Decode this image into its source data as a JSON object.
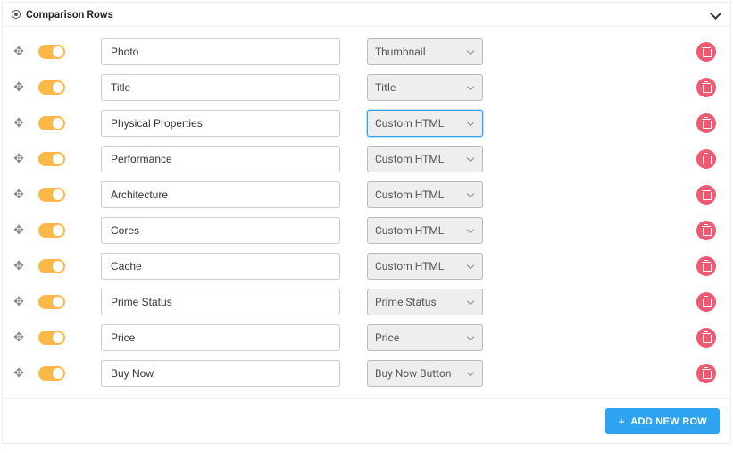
{
  "panel": {
    "title": "Comparison Rows"
  },
  "rows": [
    {
      "enabled": true,
      "name": "Photo",
      "type": "Thumbnail",
      "focused": false
    },
    {
      "enabled": true,
      "name": "Title",
      "type": "Title",
      "focused": false
    },
    {
      "enabled": true,
      "name": "Physical Properties",
      "type": "Custom HTML",
      "focused": true
    },
    {
      "enabled": true,
      "name": "Performance",
      "type": "Custom HTML",
      "focused": false
    },
    {
      "enabled": true,
      "name": "Architecture",
      "type": "Custom HTML",
      "focused": false
    },
    {
      "enabled": true,
      "name": "Cores",
      "type": "Custom HTML",
      "focused": false
    },
    {
      "enabled": true,
      "name": "Cache",
      "type": "Custom HTML",
      "focused": false
    },
    {
      "enabled": true,
      "name": "Prime Status",
      "type": "Prime Status",
      "focused": false
    },
    {
      "enabled": true,
      "name": "Price",
      "type": "Price",
      "focused": false
    },
    {
      "enabled": true,
      "name": "Buy Now",
      "type": "Buy Now Button",
      "focused": false
    }
  ],
  "footer": {
    "add_button_label": "ADD NEW ROW"
  }
}
